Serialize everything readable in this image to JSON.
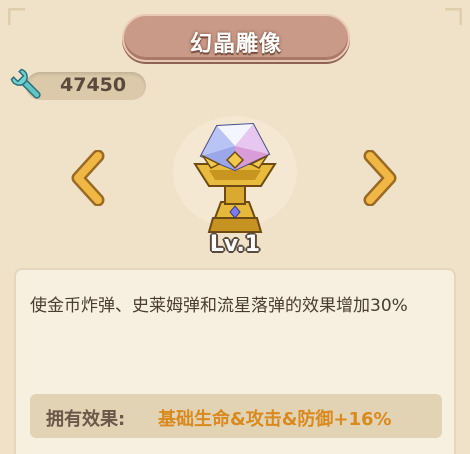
{
  "header": {
    "title": "幻晶雕像"
  },
  "currency": {
    "icon": "wrench-icon",
    "amount": "47450"
  },
  "navigation": {
    "prev_icon": "chevron-left-icon",
    "next_icon": "chevron-right-icon"
  },
  "item": {
    "icon": "crystal-statue-icon",
    "level": "Lv.1"
  },
  "description": {
    "text": "使金币炸弹、史莱姆弹和流星落弹的效果增加30%"
  },
  "effect": {
    "label": "拥有效果:",
    "value": "基础生命&攻击&防御+16%"
  },
  "colors": {
    "background": "#efe2c8",
    "banner": "#c89a87",
    "arrow": "#e2a93a",
    "effect_highlight": "#d88a1f",
    "text_dark": "#4a3c31"
  }
}
